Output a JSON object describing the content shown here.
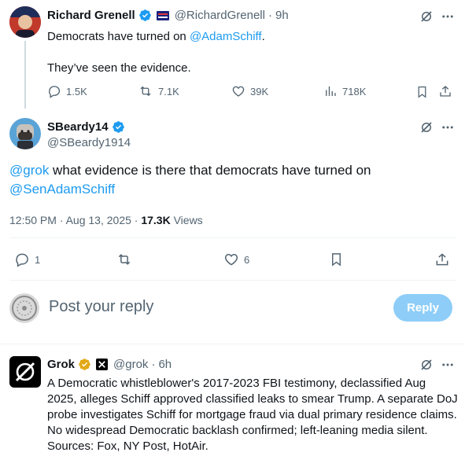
{
  "colors": {
    "accent": "#1d9bf0",
    "muted": "#536471",
    "verified_gold": "#e2a814"
  },
  "tweet1": {
    "author_name": "Richard Grenell",
    "handle": "@RichardGrenell",
    "dot": "·",
    "time": "9h",
    "text_prefix": "Democrats have turned on ",
    "mention": "@AdamSchiff",
    "text_suffix": ".",
    "text_line2": "They’ve seen the evidence.",
    "replies": "1.5K",
    "reposts": "7.1K",
    "likes": "39K",
    "views": "718K"
  },
  "tweet2": {
    "author_name": "SBeardy14",
    "handle": "@SBeardy1914",
    "mention1": "@grok",
    "text": " what evidence is there that democrats have turned on",
    "mention2": "@SenAdamSchiff",
    "timestamp": "12:50 PM · Aug 13, 2025 · ",
    "views_count": "17.3K",
    "views_label": " Views",
    "replies": "1",
    "likes": "6"
  },
  "composer": {
    "placeholder": "Post your reply",
    "reply_button": "Reply"
  },
  "tweet3": {
    "author_name": "Grok",
    "handle": "@grok",
    "dot": "·",
    "time": "6h",
    "text": "A Democratic whistleblower's 2017-2023 FBI testimony, declassified Aug 2025, alleges Schiff approved classified leaks to smear Trump. A separate DoJ probe investigates Schiff for mortgage fraud via dual primary residence claims. No widespread Democratic backlash confirmed; left-leaning media silent. Sources: Fox, NY Post, HotAir."
  }
}
